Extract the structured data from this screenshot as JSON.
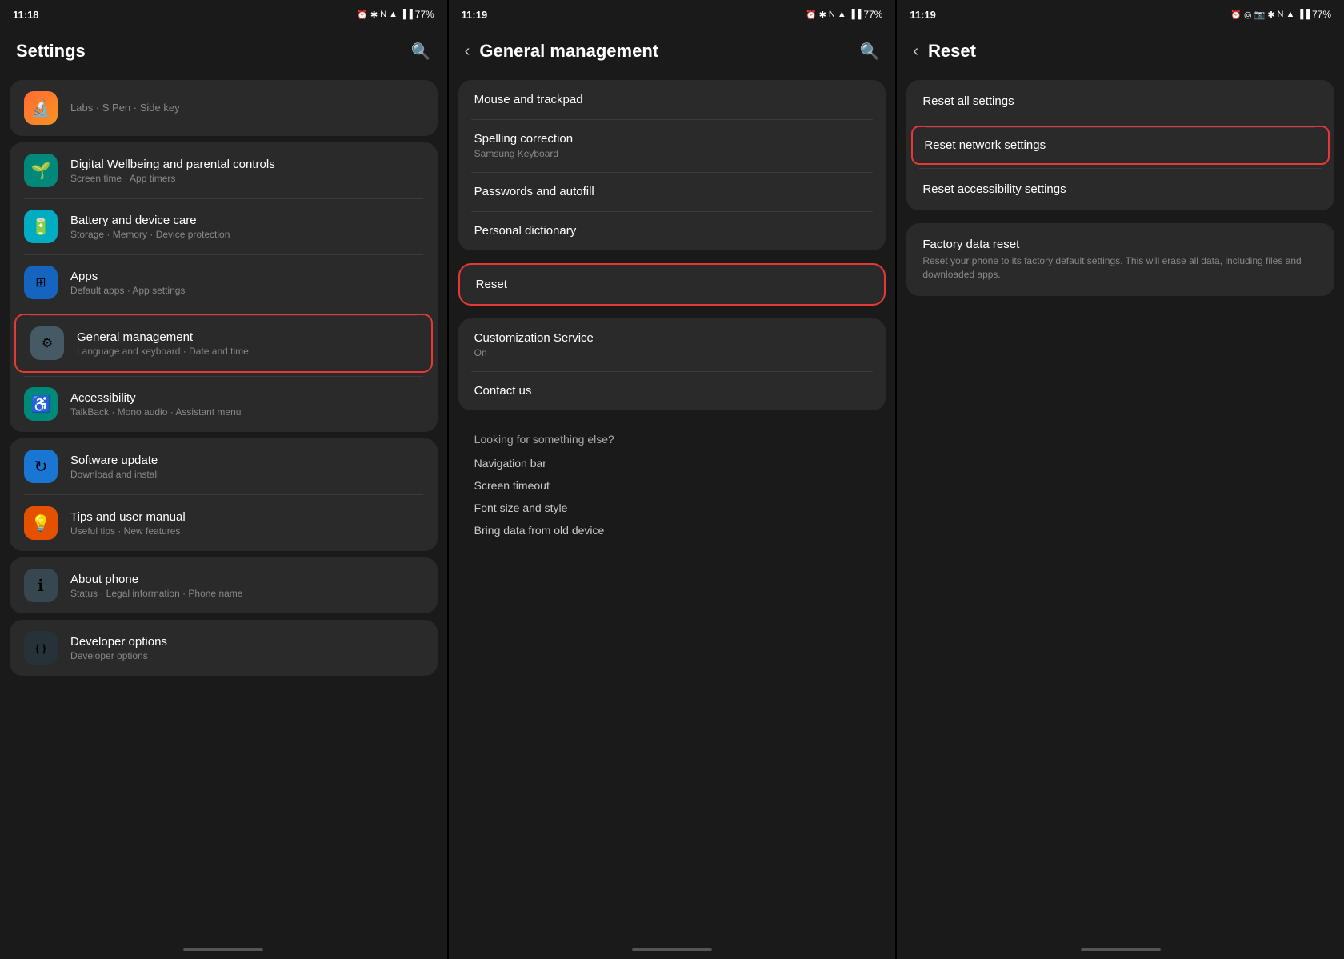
{
  "panel1": {
    "status": {
      "time": "11:18",
      "battery": "77%"
    },
    "title": "Settings",
    "labs_item": {
      "subtitle": "Labs · S Pen · Side key"
    },
    "items": [
      {
        "id": "digital-wellbeing",
        "icon": "🟢",
        "icon_bg": "icon-green",
        "title": "Digital Wellbeing and parental controls",
        "subtitle": "Screen time · App timers"
      },
      {
        "id": "battery",
        "icon": "⚙",
        "icon_bg": "icon-teal",
        "title": "Battery and device care",
        "subtitle": "Storage · Memory · Device protection"
      },
      {
        "id": "apps",
        "icon": "⊞",
        "icon_bg": "icon-blue-dark",
        "title": "Apps",
        "subtitle": "Default apps · App settings"
      },
      {
        "id": "general-management",
        "icon": "≡",
        "icon_bg": "icon-gray",
        "title": "General management",
        "subtitle": "Language and keyboard · Date and time",
        "highlighted": true
      },
      {
        "id": "accessibility",
        "icon": "♿",
        "icon_bg": "icon-green",
        "title": "Accessibility",
        "subtitle": "TalkBack · Mono audio · Assistant menu"
      },
      {
        "id": "software-update",
        "icon": "↻",
        "icon_bg": "icon-blue",
        "title": "Software update",
        "subtitle": "Download and install"
      },
      {
        "id": "tips",
        "icon": "💡",
        "icon_bg": "icon-orange",
        "title": "Tips and user manual",
        "subtitle": "Useful tips · New features"
      },
      {
        "id": "about-phone",
        "icon": "ℹ",
        "icon_bg": "icon-dark",
        "title": "About phone",
        "subtitle": "Status · Legal information · Phone name"
      },
      {
        "id": "developer-options",
        "icon": "{ }",
        "icon_bg": "icon-dark2",
        "title": "Developer options",
        "subtitle": "Developer options"
      }
    ]
  },
  "panel2": {
    "status": {
      "time": "11:19",
      "battery": "77%"
    },
    "title": "General management",
    "items_group1": [
      {
        "id": "mouse-trackpad",
        "title": "Mouse and trackpad",
        "subtitle": ""
      },
      {
        "id": "spelling-correction",
        "title": "Spelling correction",
        "subtitle": "Samsung Keyboard"
      },
      {
        "id": "passwords-autofill",
        "title": "Passwords and autofill",
        "subtitle": ""
      },
      {
        "id": "personal-dictionary",
        "title": "Personal dictionary",
        "subtitle": ""
      }
    ],
    "reset_item": {
      "id": "reset",
      "title": "Reset",
      "subtitle": "",
      "highlighted": true
    },
    "items_group2": [
      {
        "id": "customization-service",
        "title": "Customization Service",
        "subtitle": "On"
      },
      {
        "id": "contact-us",
        "title": "Contact us",
        "subtitle": ""
      }
    ],
    "looking_for": {
      "label": "Looking for something else?",
      "links": [
        "Navigation bar",
        "Screen timeout",
        "Font size and style",
        "Bring data from old device"
      ]
    }
  },
  "panel3": {
    "status": {
      "time": "11:19",
      "battery": "77%"
    },
    "title": "Reset",
    "group1": [
      {
        "id": "reset-all",
        "title": "Reset all settings",
        "subtitle": ""
      },
      {
        "id": "reset-network",
        "title": "Reset network settings",
        "subtitle": "",
        "highlighted": true
      },
      {
        "id": "reset-accessibility",
        "title": "Reset accessibility settings",
        "subtitle": ""
      }
    ],
    "group2": [
      {
        "id": "factory-reset",
        "title": "Factory data reset",
        "subtitle": "Reset your phone to its factory default settings. This will erase all data, including files and downloaded apps."
      }
    ]
  }
}
